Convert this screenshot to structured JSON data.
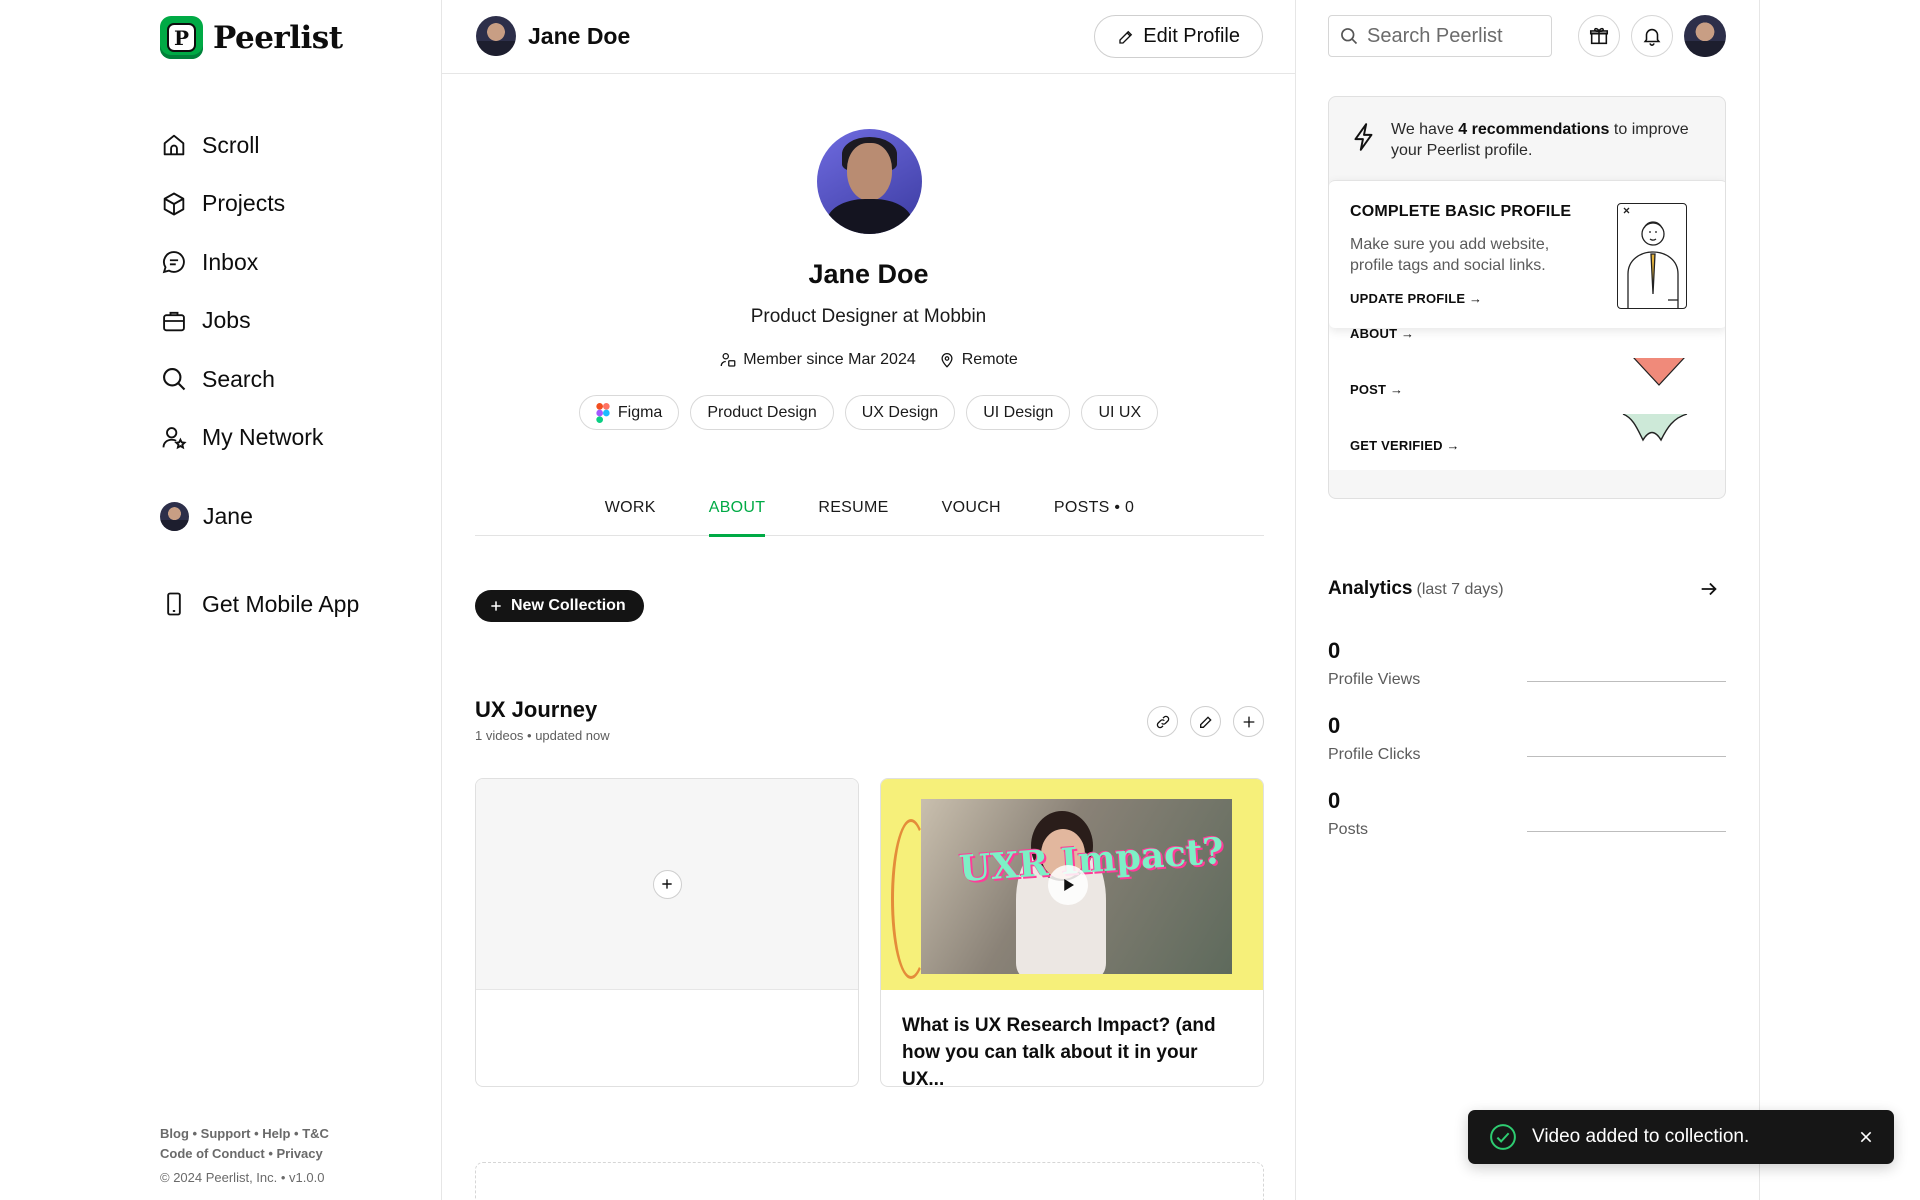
{
  "brand": {
    "name": "Peerlist",
    "mark": "P",
    "accent": "#00aa45"
  },
  "sidebar": {
    "items": [
      {
        "label": "Scroll",
        "icon": "home-icon"
      },
      {
        "label": "Projects",
        "icon": "cube-icon"
      },
      {
        "label": "Inbox",
        "icon": "chat-icon"
      },
      {
        "label": "Jobs",
        "icon": "briefcase-icon"
      },
      {
        "label": "Search",
        "icon": "search-icon"
      },
      {
        "label": "My Network",
        "icon": "network-icon"
      }
    ],
    "user_label": "Jane",
    "get_app": "Get Mobile App",
    "footer_line1": "Blog • Support • Help • T&C",
    "footer_line2": "Code of Conduct • Privacy",
    "copyright": "© 2024 Peerlist, Inc. • v1.0.0"
  },
  "header": {
    "user_name": "Jane Doe",
    "edit_profile": "Edit Profile",
    "search_placeholder": "Search Peerlist"
  },
  "profile": {
    "name": "Jane Doe",
    "headline": "Product Designer at Mobbin",
    "member_since": "Member since Mar 2024",
    "location": "Remote",
    "tags": [
      "Figma",
      "Product Design",
      "UX Design",
      "UI Design",
      "UI UX"
    ]
  },
  "tabs": [
    {
      "label": "WORK",
      "active": false
    },
    {
      "label": "ABOUT",
      "active": true
    },
    {
      "label": "RESUME",
      "active": false
    },
    {
      "label": "VOUCH",
      "active": false
    },
    {
      "label": "POSTS • 0",
      "active": false
    }
  ],
  "collections": {
    "new_button": "New Collection",
    "title": "UX Journey",
    "subtitle": "1 videos • updated now",
    "video_title": "What is UX Research Impact? (and how you can talk about it in your UX...",
    "video_overlay_text": "UXR Impact?"
  },
  "recommendations": {
    "intro_prefix": "We have ",
    "intro_bold": "4 recommendations",
    "intro_suffix": " to improve your Peerlist profile.",
    "card_title": "COMPLETE BASIC PROFILE",
    "card_desc": "Make sure you add website, profile tags and social links.",
    "card_action": "UPDATE PROFILE →",
    "rows": [
      "ABOUT →",
      "POST →",
      "GET VERIFIED →"
    ]
  },
  "analytics": {
    "title": "Analytics",
    "period": "(last 7 days)",
    "stats": [
      {
        "value": "0",
        "label": "Profile Views"
      },
      {
        "value": "0",
        "label": "Profile Clicks"
      },
      {
        "value": "0",
        "label": "Posts"
      }
    ]
  },
  "toast": {
    "message": "Video added to collection."
  }
}
